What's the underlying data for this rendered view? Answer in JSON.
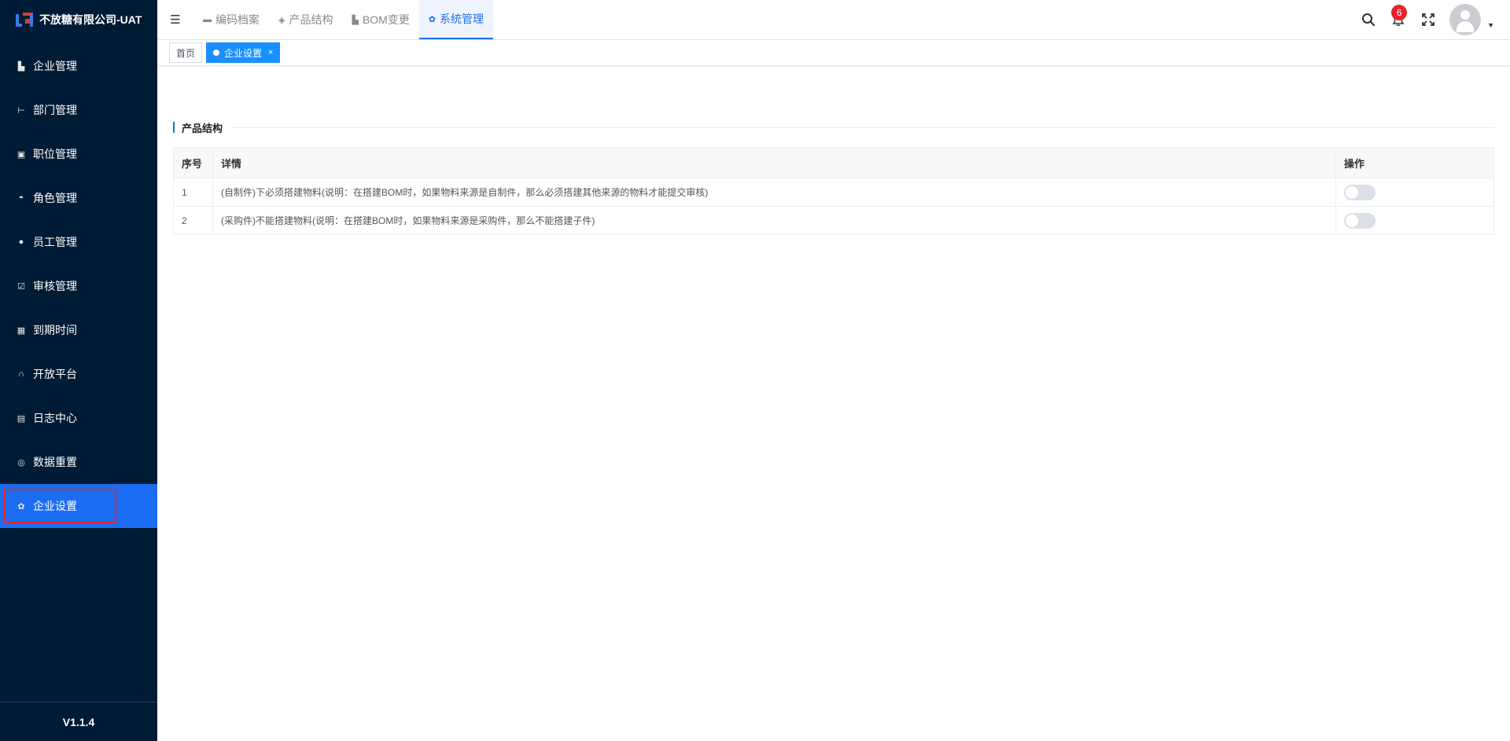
{
  "app": {
    "company": "不放糖有限公司-UAT",
    "version": "V1.1.4"
  },
  "sidebar": {
    "items": [
      {
        "label": "企业管理",
        "icon": "building-icon",
        "active": false
      },
      {
        "label": "部门管理",
        "icon": "org-tree-icon",
        "active": false
      },
      {
        "label": "职位管理",
        "icon": "id-card-icon",
        "active": false
      },
      {
        "label": "角色管理",
        "icon": "role-icon",
        "active": false
      },
      {
        "label": "员工管理",
        "icon": "user-icon",
        "active": false
      },
      {
        "label": "审核管理",
        "icon": "checkbox-icon",
        "active": false
      },
      {
        "label": "到期时间",
        "icon": "calendar-icon",
        "active": false
      },
      {
        "label": "开放平台",
        "icon": "headset-icon",
        "active": false
      },
      {
        "label": "日志中心",
        "icon": "log-icon",
        "active": false
      },
      {
        "label": "数据重置",
        "icon": "reset-icon",
        "active": false
      },
      {
        "label": "企业设置",
        "icon": "gear-icon",
        "active": true
      }
    ]
  },
  "topnav": {
    "items": [
      {
        "label": "编码档案",
        "icon": "folder-icon",
        "active": false
      },
      {
        "label": "产品结构",
        "icon": "layers-icon",
        "active": false
      },
      {
        "label": "BOM变更",
        "icon": "bom-icon",
        "active": false
      },
      {
        "label": "系统管理",
        "icon": "gear-icon",
        "active": true
      }
    ],
    "notification_count": "6"
  },
  "tags": {
    "home": "首页",
    "current": "企业设置",
    "close": "×"
  },
  "section": {
    "title": "产品结构"
  },
  "table": {
    "headers": {
      "index": "序号",
      "detail": "详情",
      "action": "操作"
    },
    "rows": [
      {
        "index": "1",
        "detail": "(自制件)下必须搭建物料(说明：在搭建BOM时，如果物料来源是自制件，那么必须搭建其他来源的物料才能提交审核)",
        "enabled": false
      },
      {
        "index": "2",
        "detail": "(采购件)不能搭建物料(说明：在搭建BOM时，如果物料来源是采购件，那么不能搭建子件)",
        "enabled": false
      }
    ]
  },
  "colors": {
    "sidebar_bg": "#001b35",
    "accent": "#1b6ef3",
    "tag_active": "#1890ff",
    "badge": "#e8232a"
  }
}
